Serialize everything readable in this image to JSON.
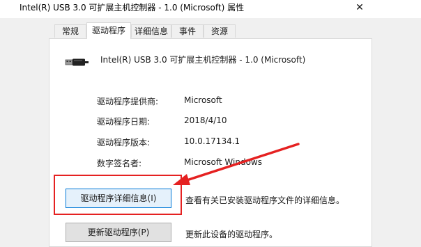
{
  "window": {
    "title": "Intel(R) USB 3.0 可扩展主机控制器 - 1.0 (Microsoft) 属性",
    "close_glyph": "✕"
  },
  "tabs": [
    {
      "label": "常规",
      "active": false
    },
    {
      "label": "驱动程序",
      "active": true
    },
    {
      "label": "详细信息",
      "active": false
    },
    {
      "label": "事件",
      "active": false
    },
    {
      "label": "资源",
      "active": false
    }
  ],
  "device": {
    "icon": "usb-connector-icon",
    "name": "Intel(R) USB 3.0 可扩展主机控制器 - 1.0 (Microsoft)"
  },
  "driver_info": [
    {
      "label": "驱动程序提供商:",
      "value": "Microsoft"
    },
    {
      "label": "驱动程序日期:",
      "value": "2018/4/10"
    },
    {
      "label": "驱动程序版本:",
      "value": "10.0.17134.1"
    },
    {
      "label": "数字签名者:",
      "value": "Microsoft Windows"
    }
  ],
  "buttons": [
    {
      "label": "驱动程序详细信息(I)",
      "description": "查看有关已安装驱动程序文件的详细信息。"
    },
    {
      "label": "更新驱动程序(P)",
      "description": "更新此设备的驱动程序。"
    }
  ],
  "annotation": {
    "color": "#e52121"
  }
}
